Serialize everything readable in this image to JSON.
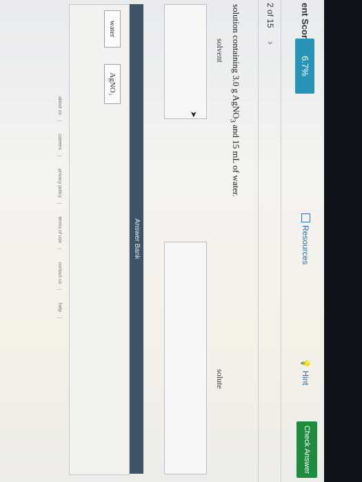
{
  "header": {
    "score_label": "ent Score:",
    "score_value": "6.7%",
    "resources_label": "Resources",
    "hint_label": "Hint",
    "check_answer_label": "Check Answer"
  },
  "navigation": {
    "question_position": "2 of 15",
    "next_glyph": "›"
  },
  "question": {
    "text_before": "solution containing 3.0 g AgNO",
    "subscript": "3",
    "text_after": " and 15 mL of water."
  },
  "drop_zones": [
    {
      "label": "solvent"
    },
    {
      "label": "solute"
    }
  ],
  "answer_bank": {
    "title": "Answer Bank",
    "items": [
      "water",
      "AgNO₃"
    ]
  },
  "footer": {
    "links": [
      "about us",
      "careers",
      "privacy policy",
      "terms of use",
      "contact us",
      "help"
    ]
  },
  "colors": {
    "score_badge": "#2a93b8",
    "check_answer": "#1f8b3f",
    "bank_bar": "#3e5365"
  }
}
